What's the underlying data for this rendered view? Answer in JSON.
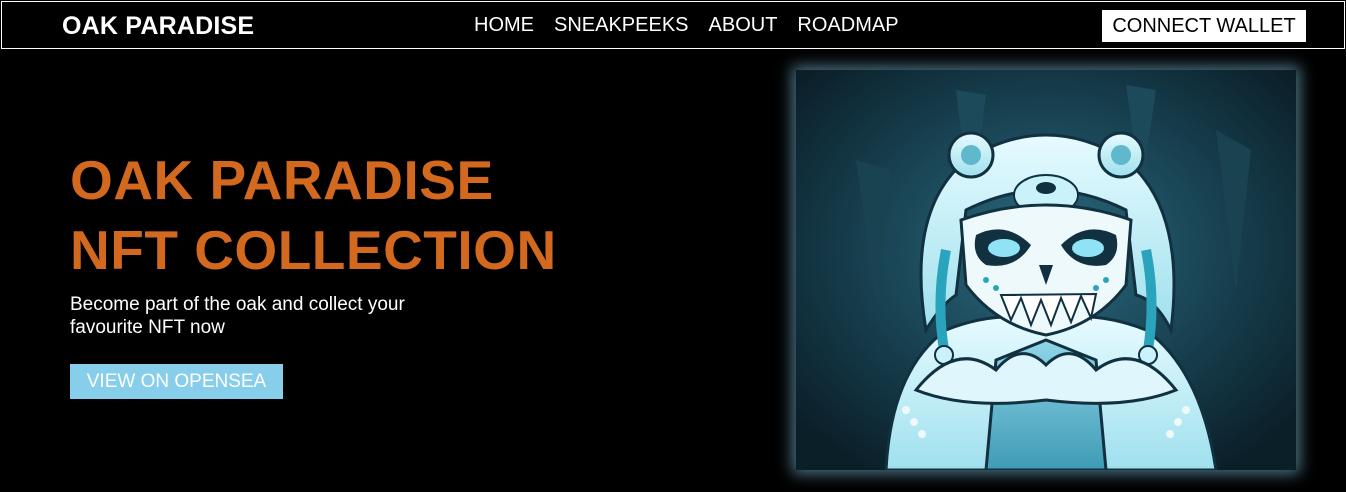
{
  "nav": {
    "brand": "OAK PARADISE",
    "links": [
      "HOME",
      "SNEAKPEEKS",
      "ABOUT",
      "ROADMAP"
    ],
    "connect_label": "CONNECT WALLET"
  },
  "hero": {
    "title_line1": "OAK PARADISE",
    "title_line2": "NFT COLLECTION",
    "subtitle_line1": "Become part of the oak and collect your",
    "subtitle_line2": "favourite NFT now",
    "cta_label": "VIEW ON OPENSEA"
  },
  "artwork": {
    "description_icon": "ice-bear-hood-skull-nft-artwork"
  },
  "colors": {
    "background": "#000000",
    "title": "#d2691e",
    "cta": "#87ceeb",
    "connect_button": "#ffffff",
    "artwork_glow": "#87ceeb"
  }
}
